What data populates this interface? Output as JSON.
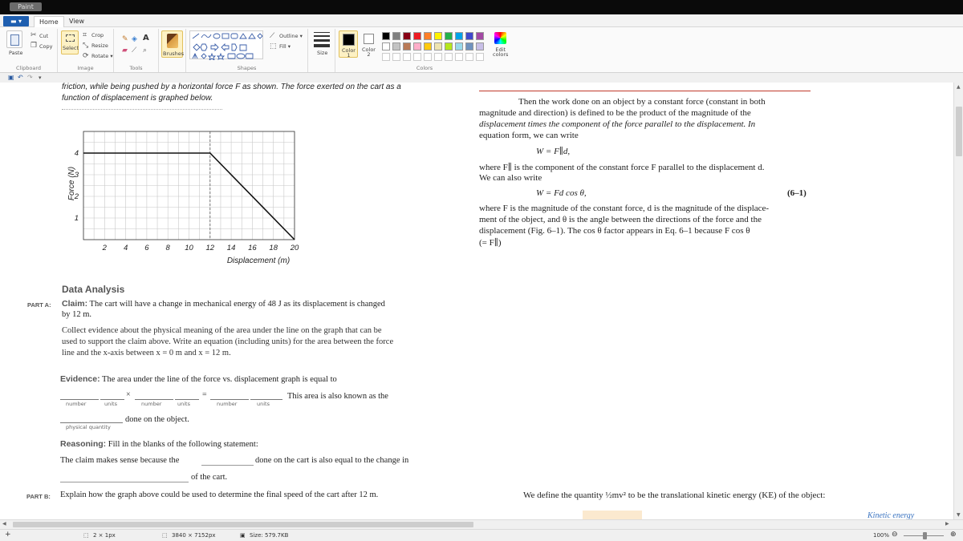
{
  "window": {
    "title_chip": "Paint"
  },
  "tabs": {
    "file_label": "▾",
    "home": "Home",
    "view": "View"
  },
  "ribbon": {
    "clipboard": {
      "paste": "Paste",
      "cut": "Cut",
      "copy": "Copy",
      "label": "Clipboard"
    },
    "image": {
      "select": "Select",
      "crop": "Crop",
      "resize": "Resize",
      "rotate": "Rotate ▾",
      "label": "Image"
    },
    "tools": {
      "label": "Tools"
    },
    "brushes": {
      "label": "Brushes"
    },
    "shapes": {
      "outline": "Outline ▾",
      "fill": "Fill ▾",
      "label": "Shapes"
    },
    "size": {
      "label": "Size"
    },
    "colors": {
      "color1": "Color\n1",
      "color2": "Color\n2",
      "edit": "Edit\ncolors",
      "label": "Colors",
      "palette": [
        "#000000",
        "#7f7f7f",
        "#880015",
        "#ed1c24",
        "#ff7f27",
        "#fff200",
        "#22b14c",
        "#00a2e8",
        "#3f48cc",
        "#a349a4",
        "#ffffff",
        "#c3c3c3",
        "#b97a57",
        "#ffaec9",
        "#ffc90e",
        "#efe4b0",
        "#b5e61d",
        "#99d9ea",
        "#7092be",
        "#c8bfe7"
      ]
    }
  },
  "document": {
    "intro_line1": "friction, while being pushed by a horizontal force F as shown. The force exerted on the cart as a",
    "intro_line2": "function of displacement is graphed below.",
    "data_analysis": "Data Analysis",
    "part_a_label": "PART A:",
    "claim_bold": "Claim:",
    "claim_text": "The cart will have a change in mechanical energy of 48 J as its displacement is changed",
    "claim_text2": "by 12 m.",
    "collect1": "Collect evidence about the physical meaning of the area under the line on the graph that can be",
    "collect2": "used to support the claim above. Write an equation (including units) for the area between the force",
    "collect3": "line and the x-axis between x = 0 m and x = 12 m.",
    "evidence_bold": "Evidence:",
    "evidence_text": "The area under the line of the force vs. displacement graph is equal to",
    "times": "×",
    "equals": "=",
    "area_known": "This area is also known as the",
    "sub_number": "number",
    "sub_units": "units",
    "done_on": "done on the object.",
    "physical_quantity": "physical quantity",
    "reasoning_bold": "Reasoning:",
    "reasoning_text": "Fill in the blanks of the following statement:",
    "claim_sense": "The claim makes sense because the",
    "claim_sense2": "done on the cart is also equal to the change in",
    "of_the_cart": "of the cart.",
    "part_b_label": "PART B:",
    "part_b_text": "Explain how the graph above could be used to determine the final speed of the cart after 12 m."
  },
  "textbook": {
    "p1_l1": "Then the work done on an object by a constant force (constant in both",
    "p1_l2": "magnitude and direction) is defined to be the product of the magnitude of the",
    "p1_l3": "displacement times the component of the force parallel to the displacement. In",
    "p1_l4": "equation form, we can write",
    "eq1": "W  =  F∥d,",
    "p2_l1": "where F∥ is the component of the constant force F parallel to the displacement d.",
    "p2_l2": "We can also write",
    "eq2": "W  =  Fd cos θ,",
    "eq2_num": "(6–1)",
    "p3_l1": "where F is the magnitude of the constant force, d is the magnitude of the displace-",
    "p3_l2": "ment of the object, and θ is the angle between the directions of the force and the",
    "p3_l3": "displacement (Fig. 6–1). The cos θ factor appears in Eq. 6–1 because F cos θ",
    "p3_l4": "(= F∥)",
    "define": "We define the quantity ½mv² to be the translational kinetic energy (KE) of the object:",
    "margin": "Kinetic energy"
  },
  "chart_data": {
    "type": "line",
    "xlabel": "Displacement (m)",
    "ylabel": "Force (N)",
    "x": [
      0,
      12,
      20
    ],
    "y": [
      4,
      4,
      0
    ],
    "xlim": [
      0,
      20
    ],
    "ylim": [
      0,
      5
    ],
    "xticks": [
      "2",
      "4",
      "6",
      "8",
      "10",
      "12",
      "14",
      "16",
      "18",
      "20"
    ],
    "yticks": [
      "1",
      "2",
      "3",
      "4"
    ],
    "grid": true,
    "marker_x": 12
  },
  "status": {
    "selection": "2 × 1px",
    "dimensions": "3840 × 7152px",
    "size": "Size: 579.7KB",
    "zoom": "100%"
  }
}
